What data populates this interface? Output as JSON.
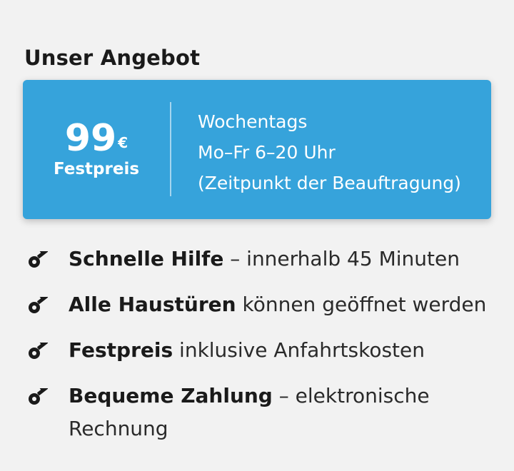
{
  "section": {
    "title": "Unser Angebot"
  },
  "offer": {
    "price_amount": "99",
    "price_currency": "€",
    "price_label": "Festpreis",
    "hours_lines": [
      "Wochentags",
      "Mo–Fr 6–20 Uhr",
      "(Zeitpunkt der Beauftragung)"
    ],
    "accent_color": "#36a3db"
  },
  "features": [
    {
      "icon": "key-icon",
      "bold": "Schnelle Hilfe",
      "rest": " – innerhalb 45 Minuten"
    },
    {
      "icon": "key-icon",
      "bold": "Alle Haustüren",
      "rest": " können geöffnet werden"
    },
    {
      "icon": "key-icon",
      "bold": "Festpreis",
      "rest": " inklusive Anfahrtskosten"
    },
    {
      "icon": "key-icon",
      "bold": "Bequeme Zahlung",
      "rest": " – elektronische Rechnung"
    }
  ]
}
